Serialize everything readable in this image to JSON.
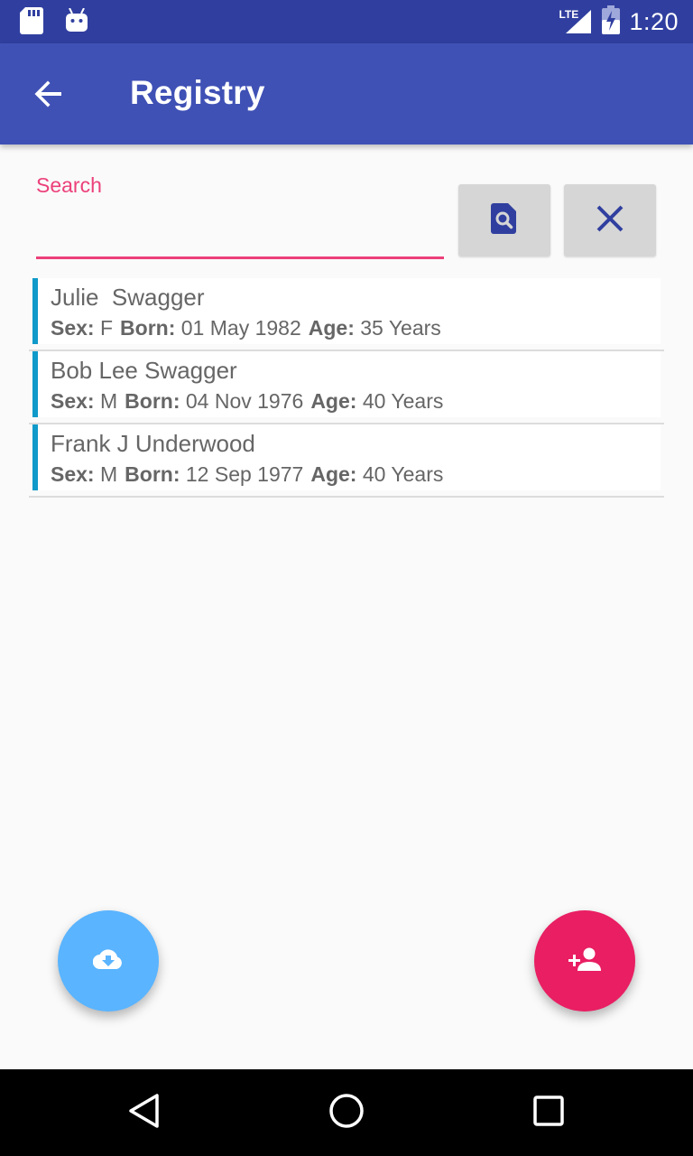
{
  "status_bar": {
    "time": "1:20",
    "network": "LTE",
    "icons": [
      "sd-card-icon",
      "android-icon",
      "lte-signal-icon",
      "battery-icon"
    ]
  },
  "app_bar": {
    "title": "Registry",
    "back_icon": "arrow-back-icon"
  },
  "search": {
    "label": "Search",
    "value": "",
    "placeholder": "",
    "search_button_icon": "find-in-page-icon",
    "clear_button_icon": "close-icon"
  },
  "labels": {
    "sex": "Sex:",
    "born": "Born:",
    "age": "Age:"
  },
  "people": [
    {
      "name": "Julie  Swagger",
      "sex": "F",
      "born": "01 May 1982",
      "age": "35 Years"
    },
    {
      "name": "Bob Lee Swagger",
      "sex": "M",
      "born": "04 Nov 1976",
      "age": "40 Years"
    },
    {
      "name": "Frank J Underwood",
      "sex": "M",
      "born": "12 Sep 1977",
      "age": "40 Years"
    }
  ],
  "fabs": {
    "download_icon": "cloud-download-icon",
    "add_icon": "person-add-icon"
  },
  "nav_bar": {
    "icons": [
      "back-triangle-icon",
      "home-circle-icon",
      "recents-square-icon"
    ]
  },
  "colors": {
    "status_bar": "#303f9f",
    "app_bar": "#3f51b5",
    "accent": "#ec407a",
    "row_stripe": "#0f9ac9",
    "fab_download": "#5ab4ff",
    "fab_add": "#e91e63"
  }
}
